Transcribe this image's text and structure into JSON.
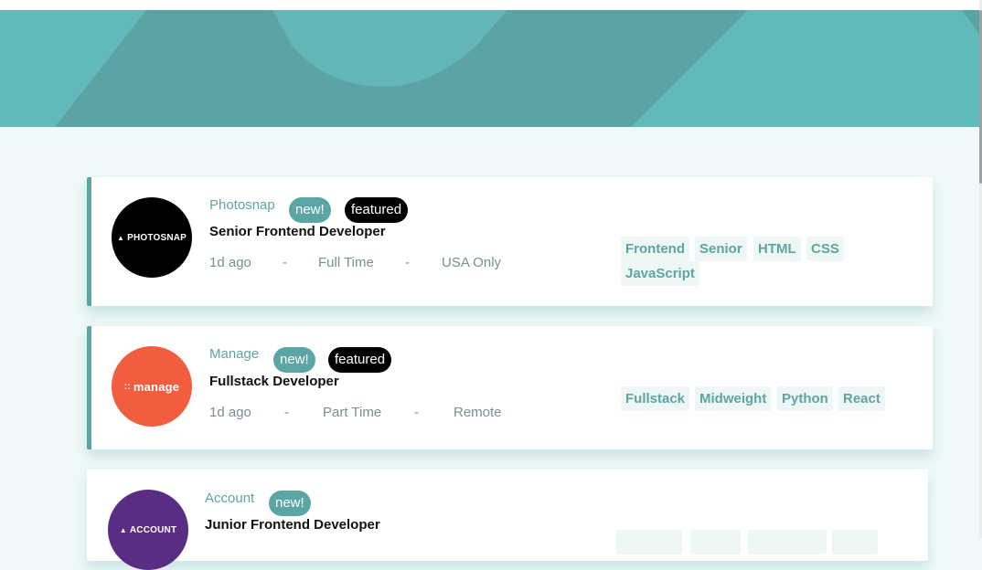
{
  "theme": {
    "accent": "#5ca5a5",
    "header_bg": "#61bab9",
    "page_bg": "#eff9f9",
    "featured_badge": "#000000"
  },
  "jobs": [
    {
      "company": "Photosnap",
      "logo_text": "PHOTOSNAP",
      "logo_bg": "#000000",
      "new_label": "new!",
      "featured_label": "featured",
      "position": "Senior Frontend Developer",
      "posted": "1d ago",
      "separator": "-",
      "contract": "Full Time",
      "location": "USA Only",
      "tags": [
        "Frontend",
        "Senior",
        "HTML",
        "CSS",
        "JavaScript"
      ]
    },
    {
      "company": "Manage",
      "logo_text": "manage",
      "logo_bg": "#f15e3f",
      "new_label": "new!",
      "featured_label": "featured",
      "position": "Fullstack Developer",
      "posted": "1d ago",
      "separator": "-",
      "contract": "Part Time",
      "location": "Remote",
      "tags": [
        "Fullstack",
        "Midweight",
        "Python",
        "React"
      ]
    },
    {
      "company": "Account",
      "logo_text": "ACCOUNT",
      "logo_bg": "#5a2d85",
      "new_label": "new!",
      "position": "Junior Frontend Developer"
    }
  ]
}
